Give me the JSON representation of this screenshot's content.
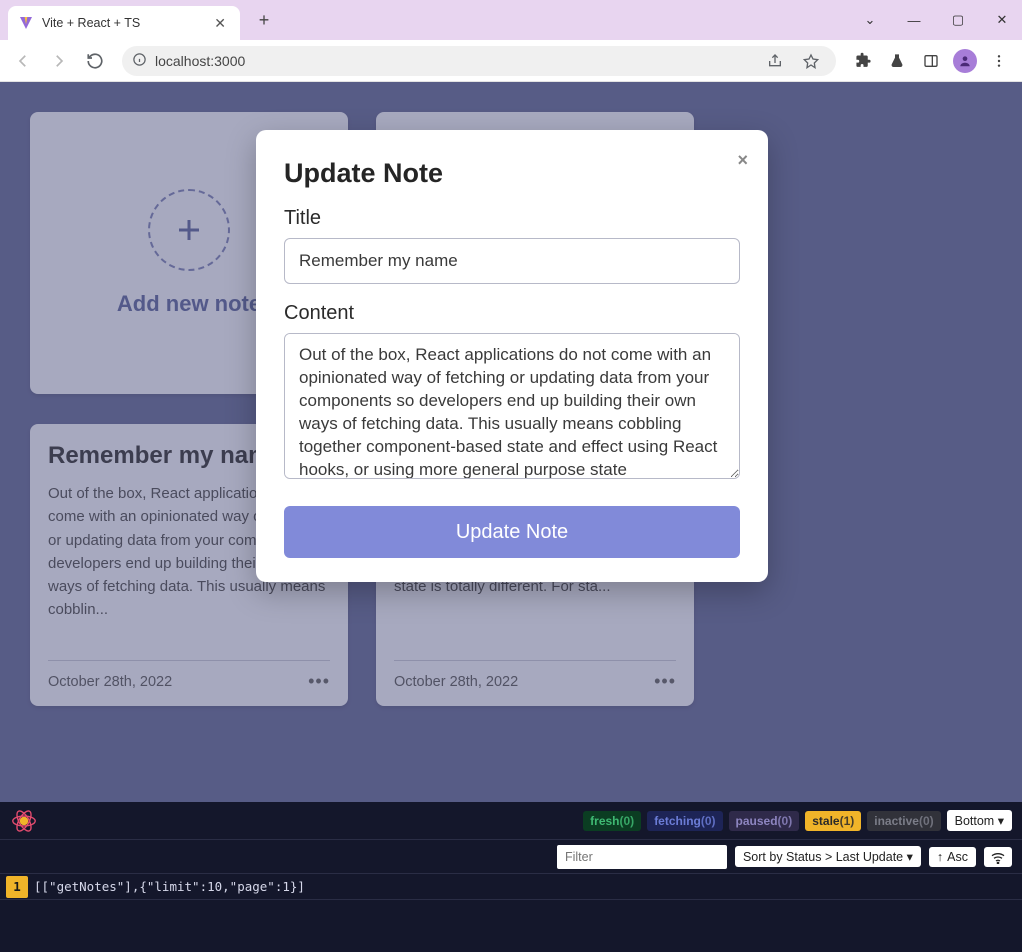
{
  "browser": {
    "tab_title": "Vite + React + TS",
    "url": "localhost:3000",
    "url_port_highlight": "3000"
  },
  "app": {
    "add_label": "Add new note",
    "notes": [
      {
        "title": "Remember my name",
        "excerpt": "Out of the box, React applications do not come with an opinionated way of fetching or updating data from your components so developers end up building their own ways of fetching data. This usually means cobblin...",
        "date": "October 28th, 2022"
      },
      {
        "title": "",
        "excerpt_tail": "or server state. This is because server state is totally different. For sta...",
        "date": "October 28th, 2022"
      }
    ]
  },
  "modal": {
    "heading": "Update Note",
    "title_label": "Title",
    "title_value": "Remember my name",
    "content_label": "Content",
    "content_value": "Out of the box, React applications do not come with an opinionated way of fetching or updating data from your components so developers end up building their own ways of fetching data. This usually means cobbling together component-based state and effect using React hooks, or using more general purpose state management libraries to store and",
    "submit_label": "Update Note",
    "close_glyph": "×"
  },
  "devtools": {
    "chips": {
      "fresh": {
        "label": "fresh",
        "count": "(0)"
      },
      "fetching": {
        "label": "fetching",
        "count": "(0)"
      },
      "paused": {
        "label": "paused",
        "count": "(0)"
      },
      "stale": {
        "label": "stale",
        "count": "(1)"
      },
      "inactive": {
        "label": "inactive",
        "count": "(0)"
      }
    },
    "position_select": "Bottom",
    "filter_placeholder": "Filter",
    "sort_label": "Sort by Status > Last Update",
    "asc_label": "Asc",
    "query_badge": "1",
    "query_text": "[[\"getNotes\"],{\"limit\":10,\"page\":1}]"
  }
}
